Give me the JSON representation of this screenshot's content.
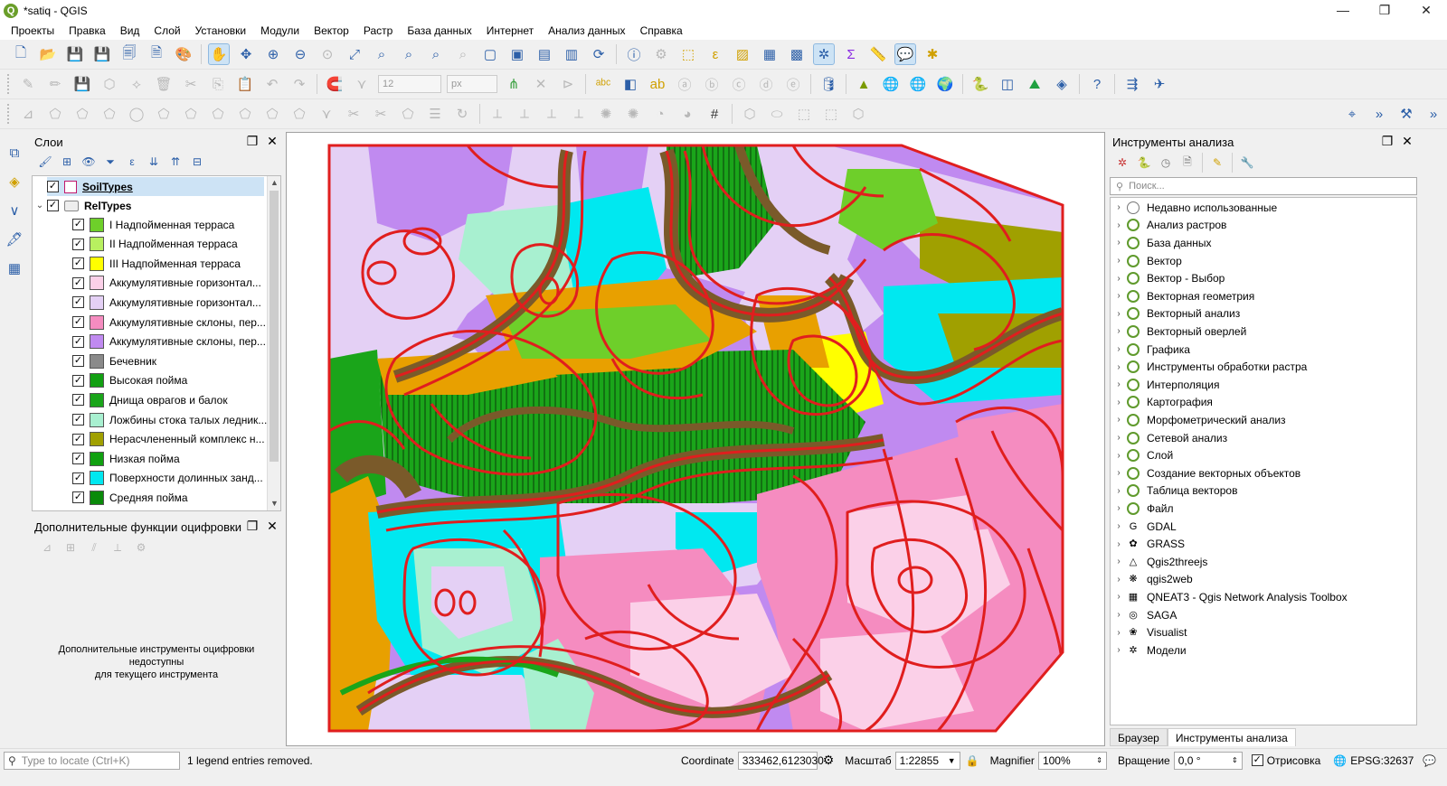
{
  "window": {
    "title": "*satiq - QGIS",
    "app_icon": "Q"
  },
  "menu": [
    "Проекты",
    "Правка",
    "Вид",
    "Слой",
    "Установки",
    "Модули",
    "Вектор",
    "Растр",
    "База данных",
    "Интернет",
    "Анализ данных",
    "Справка"
  ],
  "toolbar2": {
    "font_size": "12",
    "unit": "px"
  },
  "layers_panel": {
    "title": "Слои",
    "layer1": {
      "name": "SoilTypes",
      "checked": true
    },
    "group": {
      "name": "RelTypes",
      "checked": true
    },
    "items": [
      {
        "label": "I Надпойменная терраса",
        "color": "#6ecf2a"
      },
      {
        "label": "II Надпойменная терраса",
        "color": "#b8f060"
      },
      {
        "label": "III Надпойменная терраса",
        "color": "#ffff00"
      },
      {
        "label": "Аккумулятивные горизонтал...",
        "color": "#fbd0e8"
      },
      {
        "label": "Аккумулятивные горизонтал...",
        "color": "#e4d0f5"
      },
      {
        "label": "Аккумулятивные склоны, пер...",
        "color": "#f58cc0"
      },
      {
        "label": "Аккумулятивные склоны, пер...",
        "color": "#c08af0"
      },
      {
        "label": "Бечевник",
        "color": "#8a8a8a"
      },
      {
        "label": "Высокая пойма",
        "color": "#12a012"
      },
      {
        "label": "Днища оврагов и балок",
        "color": "#1aa51a"
      },
      {
        "label": "Ложбины стока талых ледник...",
        "color": "#a8f0d0"
      },
      {
        "label": "Нерасчлененный комплекс н...",
        "color": "#a0a000"
      },
      {
        "label": "Низкая пойма",
        "color": "#10a010"
      },
      {
        "label": "Поверхности долинных занд...",
        "color": "#00e8f0"
      },
      {
        "label": "Средняя пойма",
        "color": "#0a8a0a"
      }
    ]
  },
  "digitizing_panel": {
    "title": "Дополнительные функции оцифровки",
    "message_line1": "Дополнительные инструменты оцифровки недоступны",
    "message_line2": "для текущего инструмента"
  },
  "processing_panel": {
    "title": "Инструменты анализа",
    "search_placeholder": "Поиск...",
    "items": [
      {
        "label": "Недавно использованные",
        "icon": "clock-icon"
      },
      {
        "label": "Анализ растров",
        "icon": "qgis-icon"
      },
      {
        "label": "База данных",
        "icon": "qgis-icon"
      },
      {
        "label": "Вектор",
        "icon": "qgis-icon"
      },
      {
        "label": "Вектор - Выбор",
        "icon": "qgis-icon"
      },
      {
        "label": "Векторная геометрия",
        "icon": "qgis-icon"
      },
      {
        "label": "Векторный анализ",
        "icon": "qgis-icon"
      },
      {
        "label": "Векторный оверлей",
        "icon": "qgis-icon"
      },
      {
        "label": "Графика",
        "icon": "qgis-icon"
      },
      {
        "label": "Инструменты обработки растра",
        "icon": "qgis-icon"
      },
      {
        "label": "Интерполяция",
        "icon": "qgis-icon"
      },
      {
        "label": "Картография",
        "icon": "qgis-icon"
      },
      {
        "label": "Морфометрический анализ",
        "icon": "qgis-icon"
      },
      {
        "label": "Сетевой анализ",
        "icon": "qgis-icon"
      },
      {
        "label": "Слой",
        "icon": "qgis-icon"
      },
      {
        "label": "Создание векторных объектов",
        "icon": "qgis-icon"
      },
      {
        "label": "Таблица векторов",
        "icon": "qgis-icon"
      },
      {
        "label": "Файл",
        "icon": "qgis-icon"
      },
      {
        "label": "GDAL",
        "icon": "gdal-icon"
      },
      {
        "label": "GRASS",
        "icon": "grass-icon"
      },
      {
        "label": "Qgis2threejs",
        "icon": "qgis2threejs-icon"
      },
      {
        "label": "qgis2web",
        "icon": "qgis2web-icon"
      },
      {
        "label": "QNEAT3 - Qgis Network Analysis Toolbox",
        "icon": "qneat3-icon"
      },
      {
        "label": "SAGA",
        "icon": "saga-icon"
      },
      {
        "label": "Visualist",
        "icon": "visualist-icon"
      },
      {
        "label": "Модели",
        "icon": "models-icon"
      }
    ],
    "tabs": [
      "Браузер",
      "Инструменты анализа"
    ],
    "active_tab": "Инструменты анализа"
  },
  "statusbar": {
    "locate_placeholder": "Type to locate (Ctrl+K)",
    "message": "1 legend entries removed.",
    "coordinate_label": "Coordinate",
    "coordinate_value": "333462,6123030",
    "scale_label": "Масштаб",
    "scale_value": "1:22855",
    "magnifier_label": "Magnifier",
    "magnifier_value": "100%",
    "rotation_label": "Вращение",
    "rotation_value": "0,0 °",
    "render_label": "Отрисовка",
    "render_checked": true,
    "crs": "EPSG:32637"
  },
  "colors": {
    "accent": "#2c5fa8",
    "boundary": "#e01e1e",
    "selection": "#cde3f5"
  }
}
